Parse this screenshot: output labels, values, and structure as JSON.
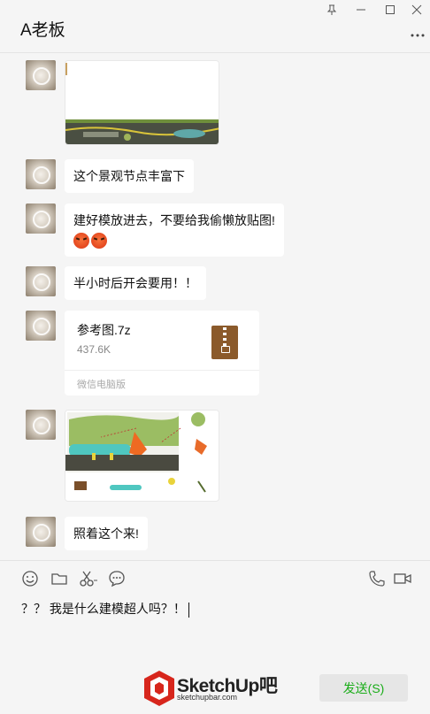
{
  "window": {
    "title": "A老板"
  },
  "messages": [
    {
      "type": "image",
      "description": "landscape rendering"
    },
    {
      "type": "text",
      "text": "这个景观节点丰富下"
    },
    {
      "type": "text",
      "text": "建好模放进去，不要给我偷懒放贴图!",
      "emoji": [
        "angry-face-icon",
        "angry-face-icon"
      ]
    },
    {
      "type": "text",
      "text": "半小时后开会要用！！"
    },
    {
      "type": "file",
      "name": "参考图.7z",
      "size": "437.6K",
      "source": "微信电脑版"
    },
    {
      "type": "image",
      "description": "reference collage"
    },
    {
      "type": "text",
      "text": "照着这个来!"
    }
  ],
  "toolbar": {
    "icons": [
      "emoji-icon",
      "folder-icon",
      "scissors-icon",
      "chat-bubble-icon",
      "phone-icon",
      "video-icon"
    ]
  },
  "input": {
    "value": "？？ 我是什么建模超人吗？！"
  },
  "send_button": {
    "label": "发送(S)"
  },
  "watermark": {
    "brand": "SketchUp吧",
    "url": "sketchupbar.com"
  },
  "colors": {
    "accent": "#1aad19",
    "background": "#f5f5f5",
    "bubble": "#ffffff"
  }
}
